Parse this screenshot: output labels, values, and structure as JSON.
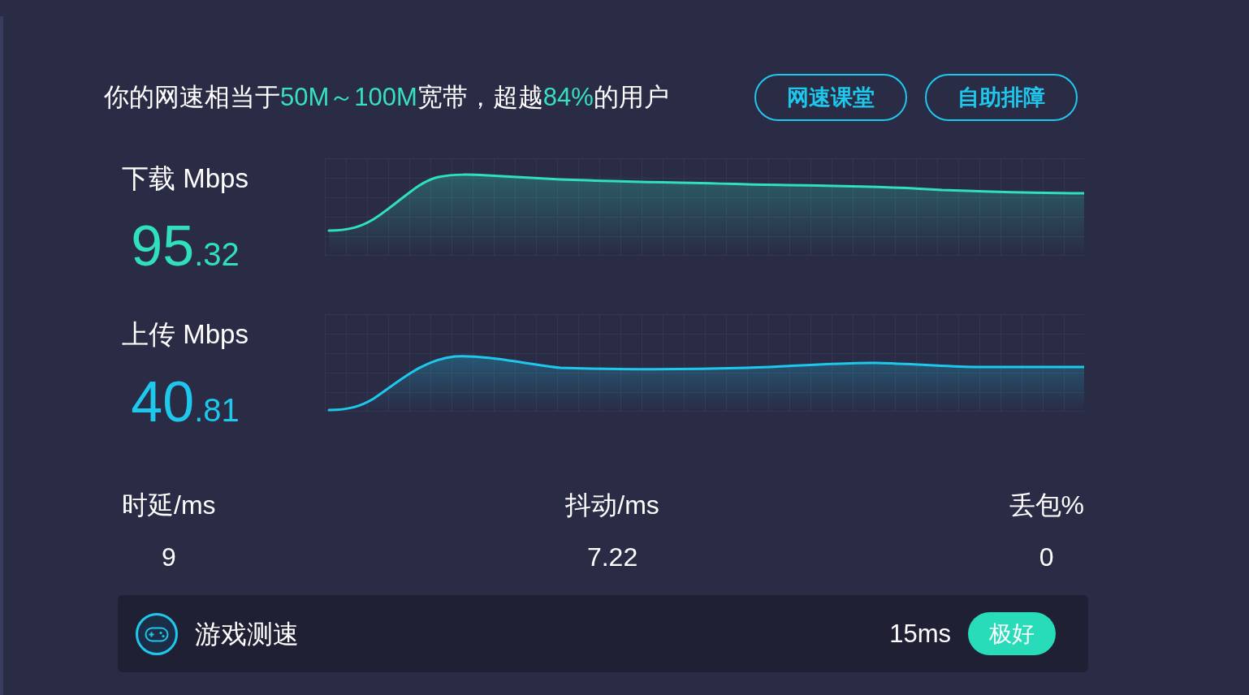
{
  "summary": [
    {
      "text": "你的网速相当于",
      "highlight": false
    },
    {
      "text": "50M～100M",
      "highlight": true
    },
    {
      "text": "宽带，超越",
      "highlight": false
    },
    {
      "text": "84%",
      "highlight": true
    },
    {
      "text": "的用户",
      "highlight": false
    }
  ],
  "buttons": [
    {
      "label": "网速课堂"
    },
    {
      "label": "自助排障"
    }
  ],
  "speeds": [
    {
      "kind": "download",
      "label": "下载 Mbps",
      "value": "95.32",
      "color": "#2fe0ba"
    },
    {
      "kind": "upload",
      "label": "上传 Mbps",
      "value": "40.81",
      "color": "#1ec8ec"
    }
  ],
  "metrics": [
    {
      "label": "时延/ms",
      "value": "9"
    },
    {
      "label": "抖动/ms",
      "value": "7.22"
    },
    {
      "label": "丢包%",
      "value": "0"
    }
  ],
  "game_test": {
    "label": "游戏测速",
    "latency": "15ms",
    "rating": "极好"
  }
}
